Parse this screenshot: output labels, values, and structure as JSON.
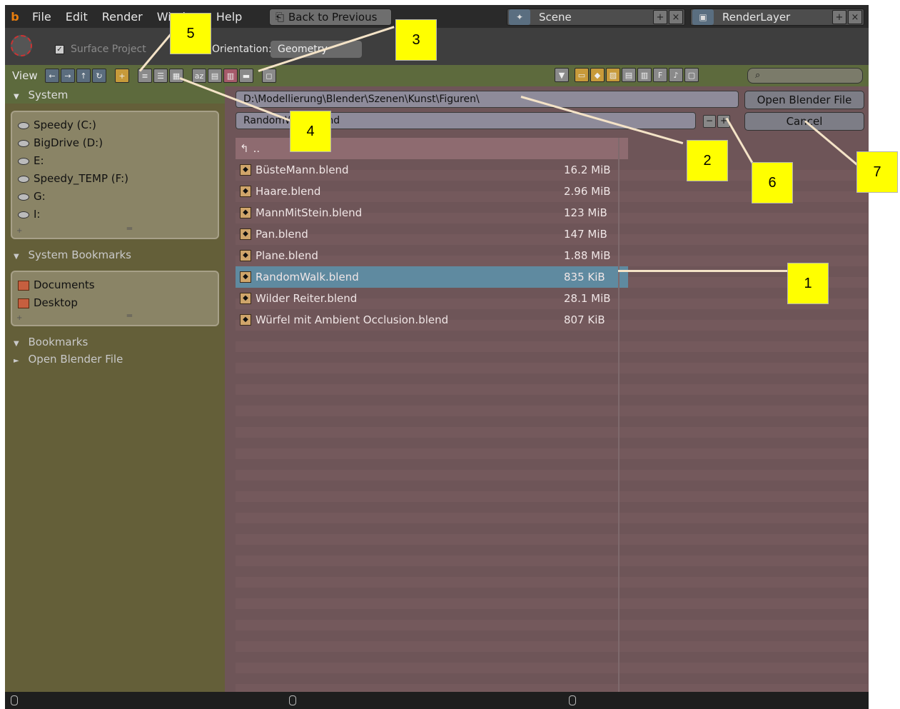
{
  "menubar": {
    "logo": "b",
    "items": [
      "File",
      "Edit",
      "Render",
      "Window",
      "Help"
    ],
    "back_button": "Back to Previous",
    "scene": "Scene",
    "render_layer": "RenderLayer"
  },
  "toolbar2": {
    "surface_label": "Surface Project",
    "orientation_label": "Orientation:",
    "geometry_value": "Geometry"
  },
  "header": {
    "view_label": "View"
  },
  "sidebar": {
    "system_header": "System",
    "drives": [
      "Speedy (C:)",
      "BigDrive (D:)",
      "E:",
      "Speedy_TEMP (F:)",
      "G:",
      "I:"
    ],
    "system_bookmarks_header": "System Bookmarks",
    "system_bookmarks": [
      "Documents",
      "Desktop"
    ],
    "bookmarks_header": "Bookmarks",
    "recent_header": "Open Blender File"
  },
  "main": {
    "path": "D:\\Modellierung\\Blender\\Szenen\\Kunst\\Figuren\\",
    "filename": "RandomWalk.blend",
    "open_button": "Open Blender File",
    "cancel_button": "Cancel",
    "parent_label": "..",
    "files": [
      {
        "name": "BüsteMann.blend",
        "size": "16.2 MiB"
      },
      {
        "name": "Haare.blend",
        "size": "2.96 MiB"
      },
      {
        "name": "MannMitStein.blend",
        "size": "123 MiB"
      },
      {
        "name": "Pan.blend",
        "size": "147 MiB"
      },
      {
        "name": "Plane.blend",
        "size": "1.88 MiB"
      },
      {
        "name": "RandomWalk.blend",
        "size": "835 KiB"
      },
      {
        "name": "Wilder Reiter.blend",
        "size": "28.1 MiB"
      },
      {
        "name": "Würfel mit Ambient Occlusion.blend",
        "size": "807 KiB"
      }
    ],
    "selected_index": 5
  },
  "callouts": [
    "1",
    "2",
    "3",
    "4",
    "5",
    "6",
    "7"
  ],
  "colors": {
    "accent_selected": "#5f8aa0",
    "main_bg": "#6e5558",
    "sidebar_bg": "#645f39",
    "callout": "#ffff00"
  }
}
